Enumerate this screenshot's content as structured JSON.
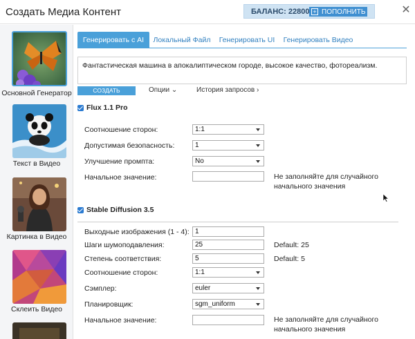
{
  "header": {
    "title": "Создать Медиа Контент",
    "balance_label": "БАЛАНС:",
    "balance_value": "22800",
    "topup_label": "ПОПОЛНИТЬ",
    "close_icon": "close-icon"
  },
  "sidebar": {
    "items": [
      {
        "label": "Основной Генератор",
        "active": true
      },
      {
        "label": "Текст в Видео",
        "active": false
      },
      {
        "label": "Картинка в Видео",
        "active": false
      },
      {
        "label": "Склеить Видео",
        "active": false
      }
    ]
  },
  "tabs": [
    {
      "label": "Генерировать с AI",
      "active": true
    },
    {
      "label": "Локальный Файл",
      "active": false
    },
    {
      "label": "Генерировать UI",
      "active": false
    },
    {
      "label": "Генерировать Видео",
      "active": false
    }
  ],
  "prompt": {
    "value": "Фантастическая машина в апокалиптическом городе, высокое качество, фотореализм."
  },
  "actions": {
    "create_label": "СОЗДАТЬ",
    "options_label": "Опции",
    "history_label": "История запросов"
  },
  "flux": {
    "name": "Flux 1.1 Pro",
    "aspect_label": "Соотношение сторон:",
    "aspect_value": "1:1",
    "safety_label": "Допустимая безопасность:",
    "safety_value": "1",
    "prompt_upsample_label": "Улучшение промпта:",
    "prompt_upsample_value": "No",
    "seed_label": "Начальное значение:",
    "seed_value": "",
    "seed_hint_line1": "Не заполняйте для случайного",
    "seed_hint_line2": "начального значения"
  },
  "sd": {
    "name": "Stable Diffusion 3.5",
    "outputs_label": "Выходные изображения (1 - 4):",
    "outputs_value": "1",
    "steps_label": "Шаги шумоподавления:",
    "steps_value": "25",
    "steps_default": "Default: 25",
    "cfg_label": "Степень соответствия:",
    "cfg_value": "5",
    "cfg_default": "Default: 5",
    "aspect_label": "Соотношение сторон:",
    "aspect_value": "1:1",
    "sampler_label": "Сэмплер:",
    "sampler_value": "euler",
    "scheduler_label": "Планировщик:",
    "scheduler_value": "sgm_uniform",
    "seed_label": "Начальное значение:",
    "seed_value": "",
    "seed_hint_line1": "Не заполняйте для случайного",
    "seed_hint_line2": "начального значения"
  },
  "colors": {
    "accent": "#4aa0d9",
    "balance_bg": "#cfe3f3",
    "topup_bg": "#3f8fd1",
    "checkbox": "#2b7bd1"
  }
}
